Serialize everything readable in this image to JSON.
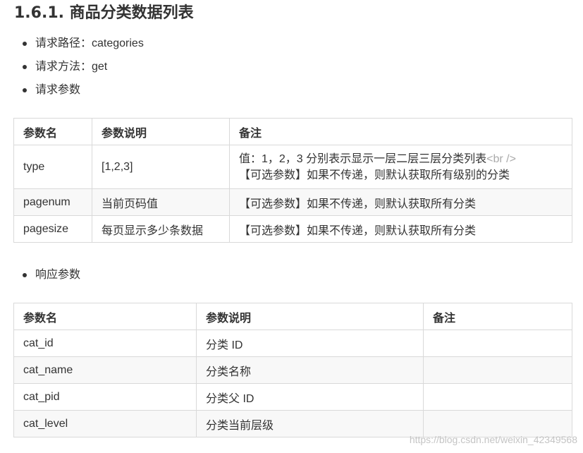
{
  "title": "1.6.1. 商品分类数据列表",
  "request_info": [
    {
      "text": "请求路径：categories"
    },
    {
      "text": "请求方法：get"
    },
    {
      "text": "请求参数"
    }
  ],
  "request_table": {
    "headers": [
      "参数名",
      "参数说明",
      "备注"
    ],
    "rows": [
      {
        "name": "type",
        "desc": "[1,2,3]",
        "note_line1": "值：1，2，3 分别表示显示一层二层三层分类列表",
        "note_tag": "<br />",
        "note_line2": "【可选参数】如果不传递，则默认获取所有级别的分类"
      },
      {
        "name": "pagenum",
        "desc": "当前页码值",
        "note": "【可选参数】如果不传递，则默认获取所有分类"
      },
      {
        "name": "pagesize",
        "desc": "每页显示多少条数据",
        "note": "【可选参数】如果不传递，则默认获取所有分类"
      }
    ]
  },
  "response_label": "响应参数",
  "response_table": {
    "headers": [
      "参数名",
      "参数说明",
      "备注"
    ],
    "rows": [
      {
        "name": "cat_id",
        "desc": "分类 ID",
        "note": ""
      },
      {
        "name": "cat_name",
        "desc": "分类名称",
        "note": ""
      },
      {
        "name": "cat_pid",
        "desc": "分类父 ID",
        "note": ""
      },
      {
        "name": "cat_level",
        "desc": "分类当前层级",
        "note": ""
      }
    ]
  },
  "watermark": "https://blog.csdn.net/weixin_42349568"
}
